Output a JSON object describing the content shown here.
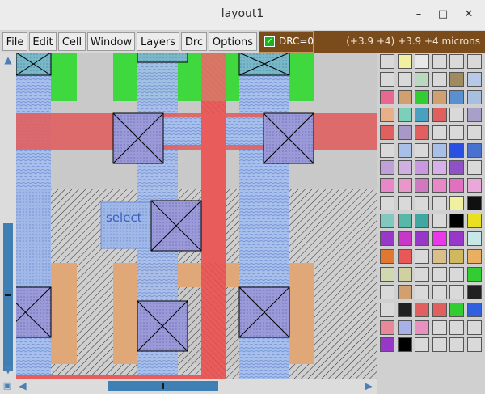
{
  "window": {
    "title": "layout1",
    "minimize_glyph": "–",
    "maximize_glyph": "□",
    "close_glyph": "✕"
  },
  "menu": {
    "items": [
      "File",
      "Edit",
      "Cell",
      "Window",
      "Layers",
      "Drc",
      "Options"
    ]
  },
  "drc": {
    "label": "DRC=0",
    "checked": true
  },
  "coords": "(+3.9 +4) +3.9 +4 microns",
  "canvas": {
    "select_label": "select"
  },
  "palette": {
    "rows": [
      [
        "#d9d9d9",
        "#f0f0a0",
        "#e8e8e8",
        "#d9d9d9",
        "#d9d9d9",
        "#d9d9d9"
      ],
      [
        "#d9d9d9",
        "#d9d9d9",
        "#b8d8c0",
        "#d9d9d9",
        "#a08a60",
        "#b8c8e8"
      ],
      [
        "#e86890",
        "#d0a070",
        "#33cc33",
        "#d0a070",
        "#5a8fd0",
        "#a8c0e0"
      ],
      [
        "#e8b088",
        "#7ad0b8",
        "#4aa0c0",
        "#e06060",
        "#d9d9d9",
        "#a8a0c8"
      ],
      [
        "#e06060",
        "#a898c8",
        "#e06060",
        "#d9d9d9",
        "#d9d9d9",
        "#d9d9d9"
      ],
      [
        "#d9d9d9",
        "#a8c0e8",
        "#d9d9d9",
        "#a8c0e8",
        "#2a50e0",
        "#4a70d0"
      ],
      [
        "#c0a0d8",
        "#d0b0e0",
        "#c898e0",
        "#d8b0e8",
        "#9050c8",
        "#d9d9d9"
      ],
      [
        "#e888c8",
        "#e898c8",
        "#d078c0",
        "#e888c8",
        "#e070c0",
        "#e8a8d8"
      ],
      [
        "#d9d9d9",
        "#d9d9d9",
        "#d9d9d9",
        "#d9d9d9",
        "#f0f0a0",
        "#101010"
      ],
      [
        "#80c8c0",
        "#58b8a8",
        "#40a8a0",
        "#d9d9d9",
        "#000000",
        "#e8e020"
      ],
      [
        "#9838c8",
        "#c838c8",
        "#9838c8",
        "#e838e8",
        "#9838c8",
        "#c8e8e8"
      ],
      [
        "#e07830",
        "#e85858",
        "#d9d9d9",
        "#d8c088",
        "#d0b860",
        "#e8b060"
      ],
      [
        "#d0d8b0",
        "#d0d0a0",
        "#d9d9d9",
        "#d9d9d9",
        "#d9d9d9",
        "#33cc33"
      ],
      [
        "#d9d9d9",
        "#d0a070",
        "#d9d9d9",
        "#d9d9d9",
        "#d9d9d9",
        "#202020"
      ],
      [
        "#d9d9d9",
        "#202020",
        "#e06060",
        "#e06060",
        "#33cc33",
        "#3060e0"
      ],
      [
        "#e88898",
        "#a8b0e8",
        "#e890c0",
        "#d9d9d9",
        "#d9d9d9",
        "#d9d9d9"
      ],
      [
        "#9838c8",
        "#000000",
        "#d9d9d9",
        "#d9d9d9",
        "#d9d9d9",
        "#d9d9d9"
      ]
    ]
  }
}
